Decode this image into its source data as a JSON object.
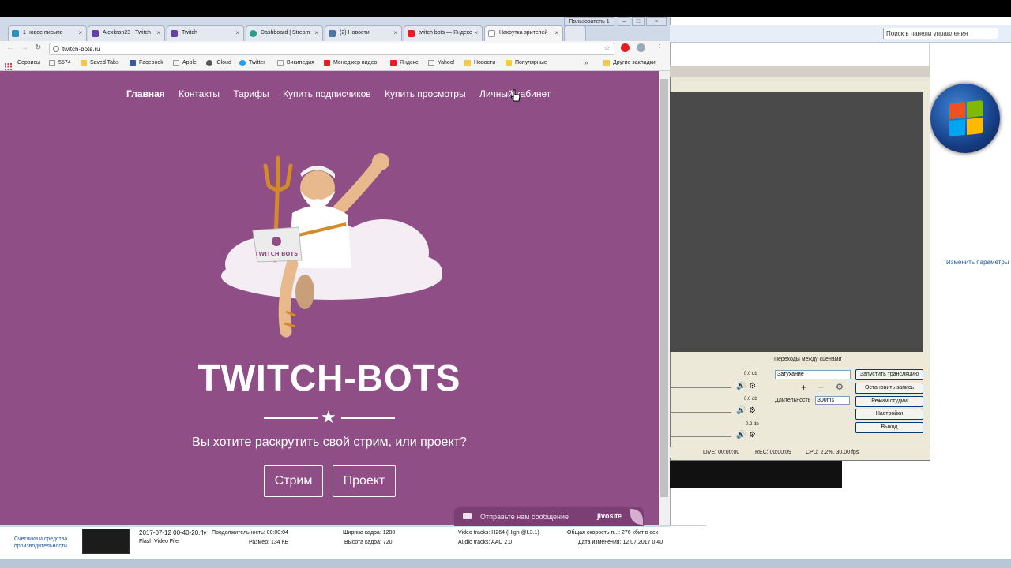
{
  "browser": {
    "tabs": [
      {
        "label": "1 новое письмо",
        "color": "#2a8fbd"
      },
      {
        "label": "Alexkron23 - Twitch",
        "color": "#6441a5"
      },
      {
        "label": "Twitch",
        "color": "#6441a5"
      },
      {
        "label": "Dashboard | Stream",
        "color": "#2b9a8a"
      },
      {
        "label": "(2) Новости",
        "color": "#4a76a8"
      },
      {
        "label": "twitch bots — Яндекс",
        "color": "#e02020"
      },
      {
        "label": "Накрутка зрителей",
        "color": "#7a7a7a"
      }
    ],
    "user_button": "Пользователь 1",
    "url": "twitch-bots.ru",
    "bookmarks": [
      {
        "label": "Сервисы",
        "color": "#cc4444"
      },
      {
        "label": "5574",
        "color": "#999"
      },
      {
        "label": "Saved Tabs",
        "color": "#f2c94c"
      },
      {
        "label": "Facebook",
        "color": "#3b5998"
      },
      {
        "label": "Apple",
        "color": "#999"
      },
      {
        "label": "iCloud",
        "color": "#555"
      },
      {
        "label": "Twitter",
        "color": "#1da1f2"
      },
      {
        "label": "Википедия",
        "color": "#999"
      },
      {
        "label": "Менеджер видео",
        "color": "#e02020"
      },
      {
        "label": "Яндекс",
        "color": "#e02020"
      },
      {
        "label": "Yahoo!",
        "color": "#999"
      },
      {
        "label": "Новости",
        "color": "#f2c94c"
      },
      {
        "label": "Популярные",
        "color": "#f2c94c"
      }
    ],
    "other_bookmarks": "Другие закладки"
  },
  "site": {
    "nav": [
      "Главная",
      "Контакты",
      "Тарифы",
      "Купить подписчиков",
      "Купить просмотры",
      "Личный кабинет"
    ],
    "laptop_logo": "TWITCH BOTS",
    "title": "TWITCH-BOTS",
    "subtitle": "Вы хотите раскрутить свой стрим, или проект?",
    "buttons": [
      "Стрим",
      "Проект"
    ],
    "chat_text": "Отправьте нам сообщение",
    "chat_brand": "jivosite",
    "accent": "#8f4e86"
  },
  "control_panel": {
    "search_placeholder": "Поиск в панели управления",
    "link": "Изменить параметры"
  },
  "obs": {
    "transitions_label": "Переходы между сценами",
    "transition_value": "Затухание",
    "duration_label": "Длительность",
    "duration_value": "300ms",
    "buttons": [
      "Запустить трансляцию",
      "Остановить запись",
      "Режим студии",
      "Настройки",
      "Выход"
    ],
    "db_levels": [
      "0.0 db",
      "0.0 db",
      "-0.2 db"
    ],
    "status": {
      "live": "LIVE: 00:00:00",
      "rec": "REC: 00:00:09",
      "cpu": "CPU: 2.2%, 30.00 fps"
    }
  },
  "explorer": {
    "left_link": "Счетчики и средства производительности",
    "file_name": "2017-07-12 00-40-20.flv",
    "file_type": "Flash Video File",
    "duration": "Продолжительность: 00:00:04",
    "size": "Размер: 134 КБ",
    "width": "Ширина кадра: 1280",
    "height": "Высота кадра: 720",
    "video_tracks": "Video tracks: H264 (High @L3.1)",
    "audio_tracks": "Audio tracks: AAC 2.0",
    "bitrate": "Общая скорость п...: 276 кбит в сек",
    "modified": "Дата изменения: 12.07.2017 0:40"
  }
}
